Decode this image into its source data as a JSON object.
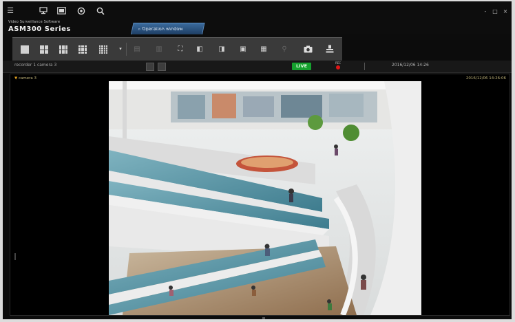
{
  "app": {
    "brand_small": "Video Surveillance Software",
    "brand_name": "ASM300 Series",
    "top_icons": [
      "menu-icon",
      "monitor-icon",
      "display-icon",
      "settings-icon",
      "search-icon"
    ],
    "window_controls": [
      "-",
      "□",
      "×"
    ],
    "tab_label": "Operation window"
  },
  "toolbar": {
    "layouts": [
      "1-split",
      "4-split",
      "6-split",
      "9-split",
      "16-split"
    ],
    "tools": [
      "layout-dropdown",
      "previous-page",
      "next-page",
      "fullscreen",
      "audio",
      "record",
      "snapshot",
      "playback",
      "alarm",
      "ptz",
      "camera",
      "ptz-control"
    ]
  },
  "infobar": {
    "camera_label": "recorder 1 camera 3",
    "live_label": "LIVE",
    "rec_label": "REC",
    "datetime": "2016/12/06 14:26"
  },
  "pane": {
    "camera_name": "camera 3",
    "timestamp": "2016/12/06 14:26:06"
  },
  "colors": {
    "accent_tab": "#2e5a8a",
    "live_green": "#15a12e",
    "rec_red": "#e01515",
    "osd_text": "#c0b47a"
  }
}
